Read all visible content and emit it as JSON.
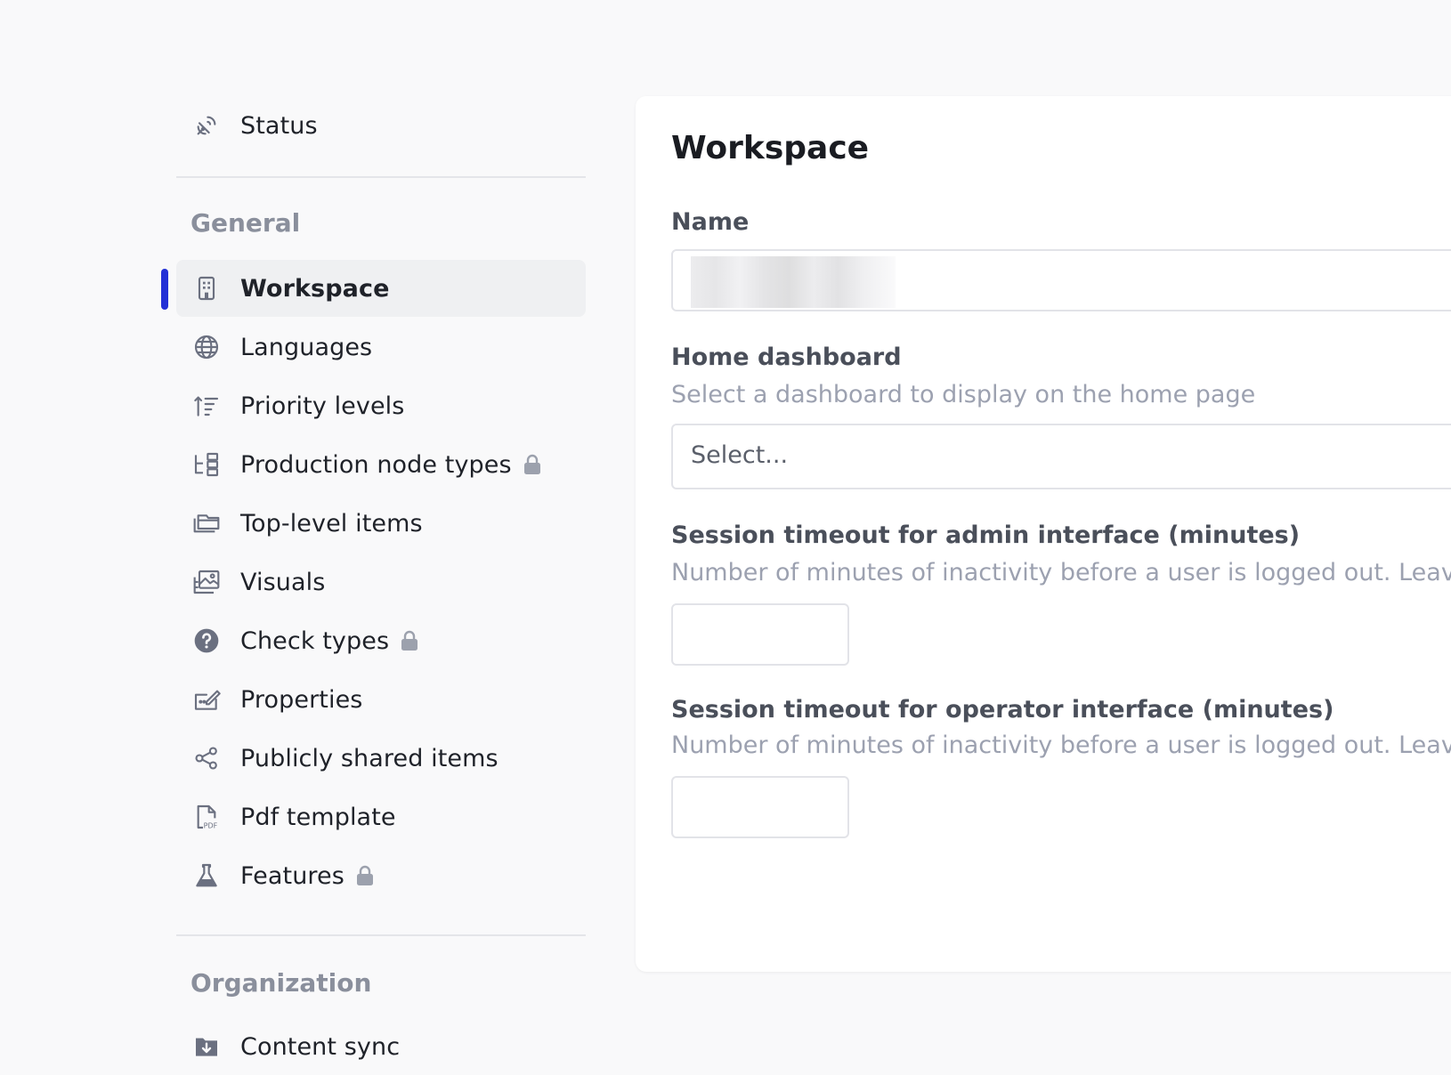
{
  "sidebar": {
    "status_label": "Status",
    "general_title": "General",
    "items": [
      {
        "label": "Workspace"
      },
      {
        "label": "Languages"
      },
      {
        "label": "Priority levels"
      },
      {
        "label": "Production node types"
      },
      {
        "label": "Top-level items"
      },
      {
        "label": "Visuals"
      },
      {
        "label": "Check types"
      },
      {
        "label": "Properties"
      },
      {
        "label": "Publicly shared items"
      },
      {
        "label": "Pdf template"
      },
      {
        "label": "Features"
      }
    ],
    "organization_title": "Organization",
    "content_sync_label": "Content sync",
    "accent_color": "#2330d6"
  },
  "panel": {
    "title": "Workspace",
    "name_label": "Name",
    "home_dashboard_label": "Home dashboard",
    "home_dashboard_help": "Select a dashboard to display on the home page",
    "home_dashboard_value": "Select...",
    "admin_timeout_label": "Session timeout for admin interface (minutes)",
    "admin_timeout_help": "Number of minutes of inactivity before a user is logged out. Leave e",
    "operator_timeout_label": "Session timeout for operator interface (minutes)",
    "operator_timeout_help": "Number of minutes of inactivity before a user is logged out. Leave e"
  }
}
